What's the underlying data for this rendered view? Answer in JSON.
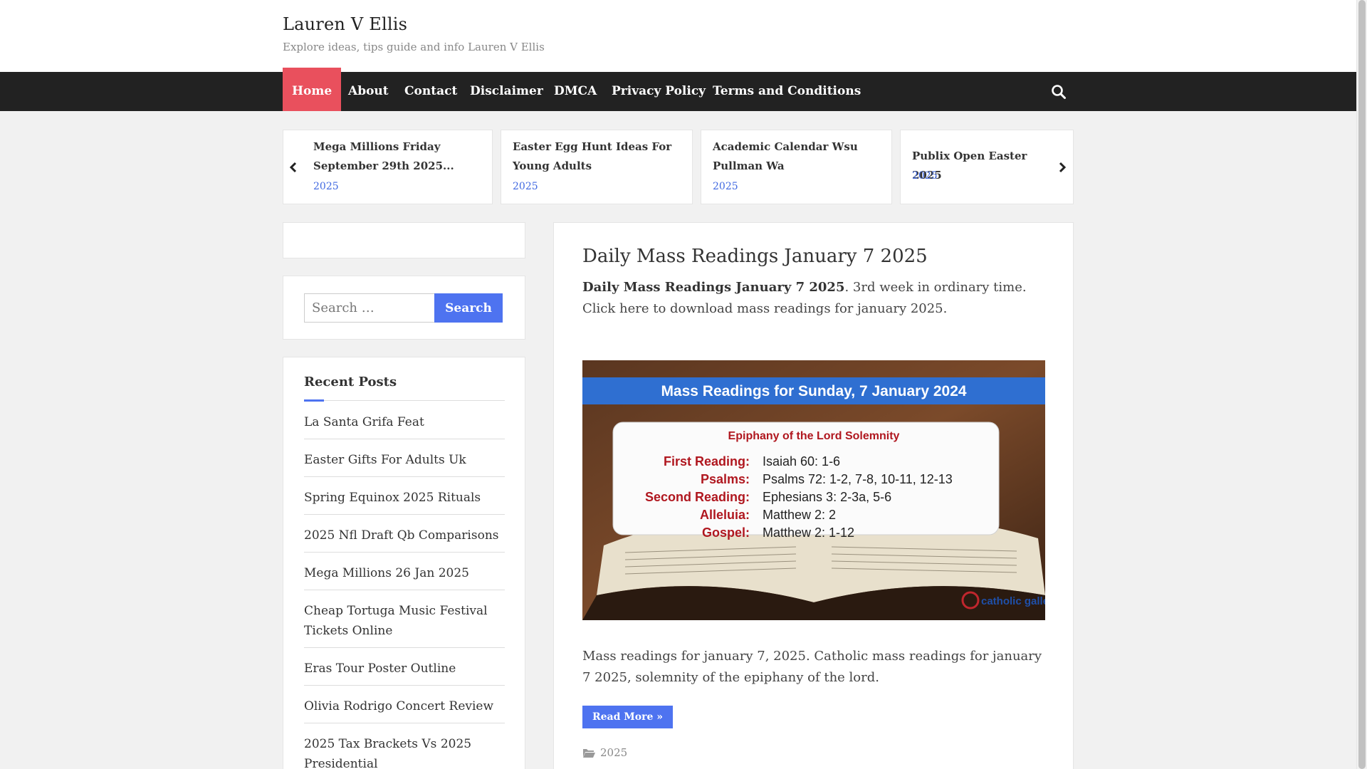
{
  "site": {
    "title": "Lauren V Ellis",
    "tagline": "Explore ideas, tips guide and info Lauren V Ellis"
  },
  "nav": {
    "items": [
      "Home",
      "About",
      "Contact",
      "Disclaimer",
      "DMCA",
      "Privacy Policy",
      "Terms and Conditions"
    ],
    "active": "Home",
    "search_icon": "search-icon"
  },
  "carousel": {
    "cards": [
      {
        "title": "Mega Millions Friday September 29th 2025...",
        "category": "2025"
      },
      {
        "title": "Easter Egg Hunt Ideas For Young Adults",
        "category": "2025"
      },
      {
        "title": "Academic Calendar Wsu Pullman Wa",
        "category": "2025"
      },
      {
        "title": "Publix Open Easter 2025",
        "category": "2025"
      }
    ],
    "prev_icon": "chevron-left-icon",
    "next_icon": "chevron-right-icon"
  },
  "sidebar": {
    "search": {
      "placeholder": "Search …",
      "button": "Search"
    },
    "recent_posts": {
      "heading": "Recent Posts",
      "items": [
        "La Santa Grifa Feat",
        "Easter Gifts For Adults Uk",
        "Spring Equinox 2025 Rituals",
        "2025 Nfl Draft Qb Comparisons",
        "Mega Millions 26 Jan 2025",
        "Cheap Tortuga Music Festival Tickets Online",
        "Eras Tour Poster Outline",
        "Olivia Rodrigo Concert Review",
        "2025 Tax Brackets Vs 2025 Presidential"
      ]
    }
  },
  "article": {
    "title": "Daily Mass Readings January 7 2025",
    "intro_bold": "Daily Mass Readings January 7 2025",
    "intro_rest": ". 3rd week in ordinary time. Click here to download mass readings for january 2025.",
    "image": {
      "banner": "Mass Readings for Sunday, 7 January 2024",
      "subtitle": "Epiphany of the Lord Solemnity",
      "readings": [
        {
          "label": "First Reading:",
          "value": "Isaiah 60: 1-6"
        },
        {
          "label": "Psalms:",
          "value": "Psalms 72: 1-2, 7-8, 10-11, 12-13"
        },
        {
          "label": "Second Reading:",
          "value": "Ephesians 3: 2-3a, 5-6"
        },
        {
          "label": "Alleluia:",
          "value": "Matthew 2: 2"
        },
        {
          "label": "Gospel:",
          "value": "Matthew 2: 1-12"
        }
      ],
      "logo": "catholic gallery"
    },
    "excerpt": "Mass readings for january 7, 2025. Catholic mass readings for january 7 2025, solemnity of the epiphany of the lord.",
    "read_more": "Read More »",
    "category": "2025",
    "category_icon": "folder-icon"
  },
  "colors": {
    "accent": "#4e73f0",
    "nav_bg": "#222222",
    "active_nav": "#e9505d"
  }
}
